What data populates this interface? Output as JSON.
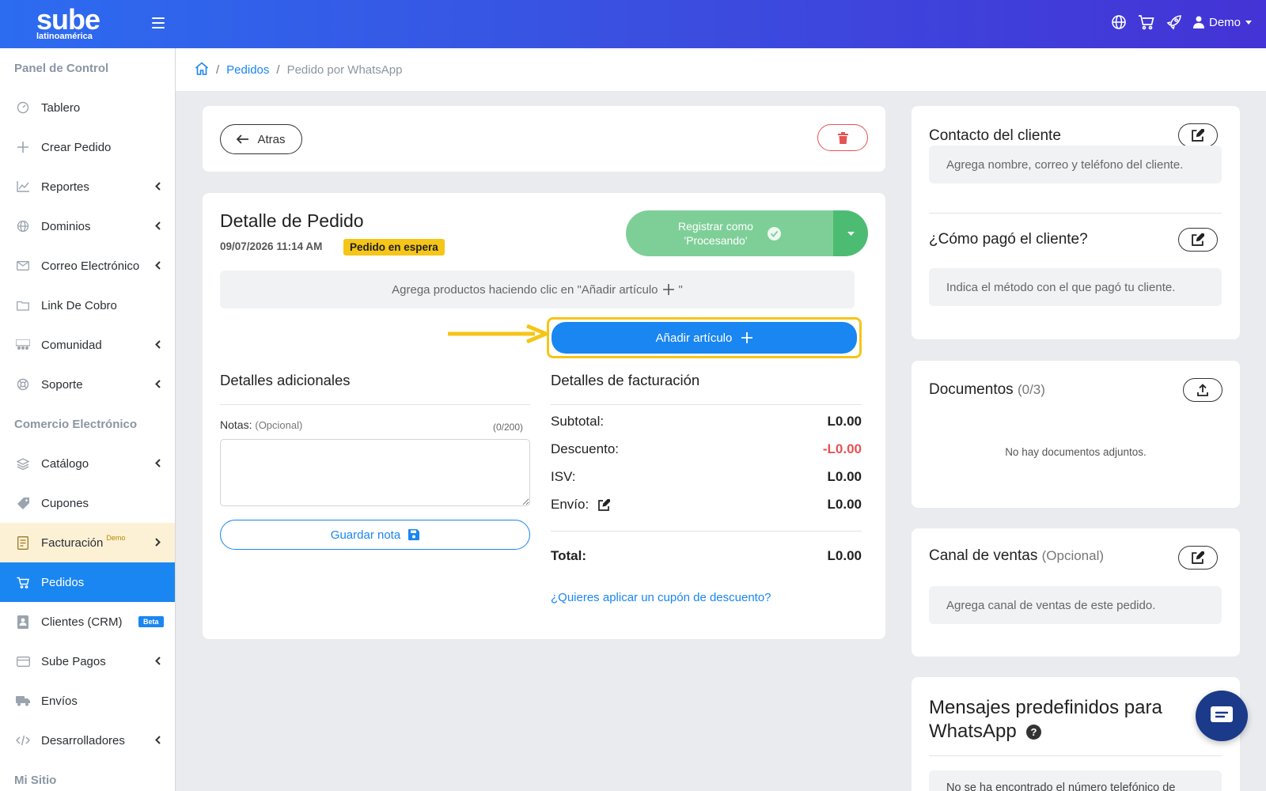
{
  "brand": {
    "name": "sube",
    "subtitle": "latinoamérica"
  },
  "topbar": {
    "user_label": "Demo"
  },
  "sidebar": {
    "section_panel": "Panel de Control",
    "section_ecommerce": "Comercio Electrónico",
    "section_site": "Mi Sitio",
    "items": [
      {
        "label": "Tablero"
      },
      {
        "label": "Crear Pedido"
      },
      {
        "label": "Reportes"
      },
      {
        "label": "Dominios"
      },
      {
        "label": "Correo Electrónico"
      },
      {
        "label": "Link De Cobro"
      },
      {
        "label": "Comunidad"
      },
      {
        "label": "Soporte"
      },
      {
        "label": "Catálogo"
      },
      {
        "label": "Cupones"
      },
      {
        "label": "Facturación",
        "tag": "Demo"
      },
      {
        "label": "Pedidos"
      },
      {
        "label": "Clientes (CRM)",
        "badge": "Beta"
      },
      {
        "label": "Sube Pagos"
      },
      {
        "label": "Envíos"
      },
      {
        "label": "Desarrolladores"
      }
    ]
  },
  "breadcrumb": {
    "parent": "Pedidos",
    "current": "Pedido por WhatsApp"
  },
  "actions": {
    "back_label": "Atras"
  },
  "order": {
    "title": "Detalle de Pedido",
    "date": "09/07/2026 11:14 AM",
    "status": "Pedido en espera",
    "register_line1": "Registrar como",
    "register_line2": "'Procesando'",
    "hint_text": "Agrega productos haciendo clic en \"Añadir artículo",
    "hint_close": "\"",
    "add_item_label": "Añadir artículo"
  },
  "additional": {
    "title": "Detalles adicionales",
    "notes_label": "Notas:",
    "notes_optional": "(Opcional)",
    "notes_count": "(0/200)",
    "save_label": "Guardar nota"
  },
  "billing": {
    "title": "Detalles de facturación",
    "subtotal_label": "Subtotal:",
    "subtotal": "L0.00",
    "discount_label": "Descuento:",
    "discount": "-L0.00",
    "tax_label": "ISV:",
    "tax": "L0.00",
    "shipping_label": "Envío:",
    "shipping": "L0.00",
    "total_label": "Total:",
    "total": "L0.00",
    "coupon_link": "¿Quieres aplicar un cupón de descuento?"
  },
  "right": {
    "contact_title": "Contacto del cliente",
    "contact_placeholder": "Agrega nombre, correo y teléfono del cliente.",
    "payment_title": "¿Cómo pagó el cliente?",
    "payment_placeholder": "Indica el método con el que pagó tu cliente.",
    "documents_title": "Documentos",
    "documents_count": "(0/3)",
    "documents_empty": "No hay documentos adjuntos.",
    "channel_title": "Canal de ventas",
    "channel_optional": "(Opcional)",
    "channel_placeholder": "Agrega canal de ventas de este pedido.",
    "messages_title_1": "Mensajes predefinidos para",
    "messages_title_2": "WhatsApp",
    "messages_text": "No se ha encontrado el número telefónico de"
  },
  "colors": {
    "accent": "#1a86f1",
    "warning": "#f5c518",
    "success": "#7ecf97",
    "danger": "#e55353"
  }
}
